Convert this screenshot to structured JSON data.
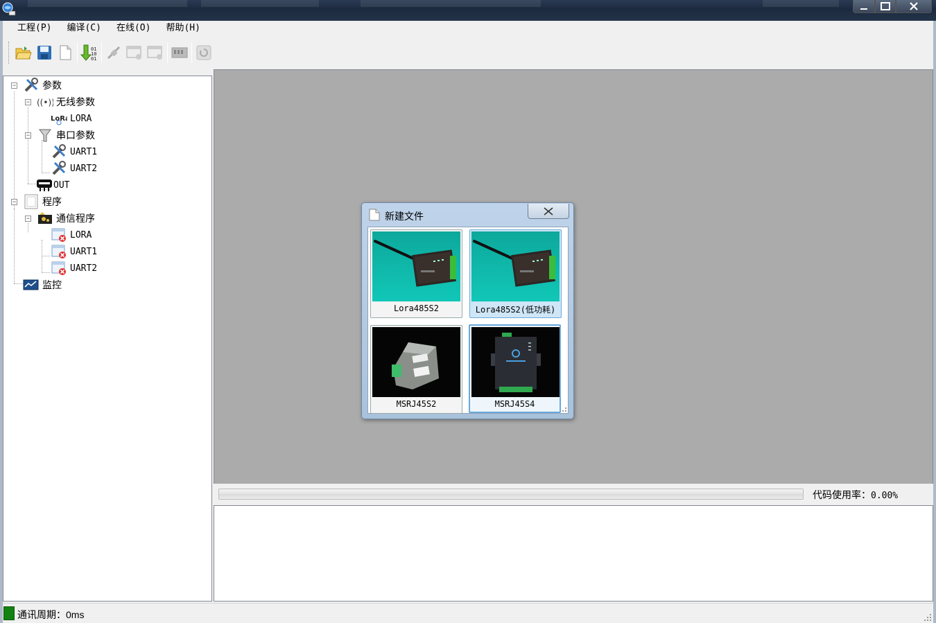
{
  "menu": [
    "工程(P)",
    "编译(C)",
    "在线(O)",
    "帮助(H)"
  ],
  "toolbar": {
    "buttons": [
      "open-folder-icon",
      "save-icon",
      "new-file-icon",
      "compile-download-icon",
      "connect-icon",
      "upload-icon",
      "download-icon",
      "device-icon",
      "refresh-icon"
    ]
  },
  "tree": {
    "params": "参数",
    "wireless": "无线参数",
    "lora_param": "LORA",
    "serial": "串口参数",
    "uart1": "UART1",
    "uart2": "UART2",
    "out": "OUT",
    "program": "程序",
    "comm_program": "通信程序",
    "prog_lora": "LORA",
    "prog_uart1": "UART1",
    "prog_uart2": "UART2",
    "monitor": "监控"
  },
  "progress": {
    "label": "代码使用率：",
    "value": "0.00%",
    "fraction": 0
  },
  "status": {
    "text": "通讯周期：0ms",
    "led_color": "#128212"
  },
  "dialog": {
    "title": "新建文件",
    "close": "X",
    "devices": [
      {
        "name": "Lora485S2",
        "selected": false
      },
      {
        "name": "Lora485S2(低功耗)",
        "selected": true
      },
      {
        "name": "MSRJ45S2",
        "selected": false
      },
      {
        "name": "MSRJ45S4",
        "selected": true
      }
    ]
  }
}
